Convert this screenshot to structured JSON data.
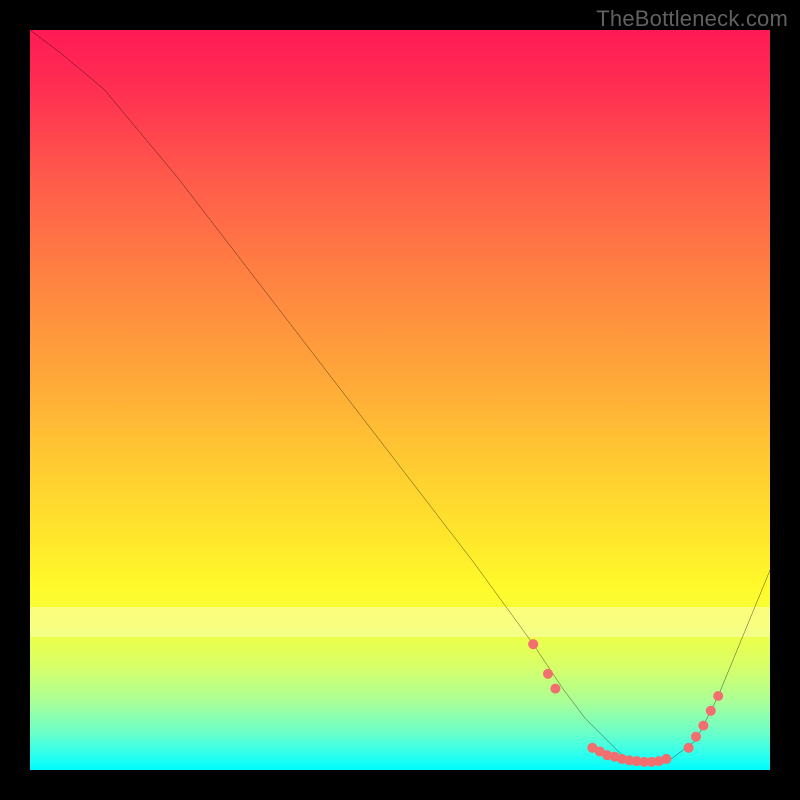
{
  "watermark": "TheBottleneck.com",
  "chart_data": {
    "type": "line",
    "title": "",
    "xlabel": "",
    "ylabel": "",
    "xlim": [
      0,
      100
    ],
    "ylim": [
      0,
      100
    ],
    "grid": false,
    "series": [
      {
        "name": "curve",
        "color": "#000000",
        "x": [
          0,
          4,
          10,
          20,
          30,
          40,
          50,
          60,
          68,
          72,
          75,
          78,
          80,
          83,
          86,
          90,
          93,
          100
        ],
        "y": [
          100,
          97,
          92,
          80,
          67,
          54,
          41,
          28,
          17,
          11,
          7,
          4,
          2,
          1,
          1,
          4,
          10,
          27
        ]
      }
    ],
    "markers": {
      "color": "#f36f6f",
      "radius": 5,
      "points": [
        {
          "x": 68,
          "y": 17
        },
        {
          "x": 70,
          "y": 13
        },
        {
          "x": 71,
          "y": 11
        },
        {
          "x": 76,
          "y": 3
        },
        {
          "x": 77,
          "y": 2.5
        },
        {
          "x": 78,
          "y": 2
        },
        {
          "x": 79,
          "y": 1.8
        },
        {
          "x": 80,
          "y": 1.5
        },
        {
          "x": 81,
          "y": 1.3
        },
        {
          "x": 82,
          "y": 1.2
        },
        {
          "x": 83,
          "y": 1.1
        },
        {
          "x": 84,
          "y": 1.1
        },
        {
          "x": 85,
          "y": 1.2
        },
        {
          "x": 86,
          "y": 1.5
        },
        {
          "x": 89,
          "y": 3
        },
        {
          "x": 90,
          "y": 4.5
        },
        {
          "x": 91,
          "y": 6
        },
        {
          "x": 92,
          "y": 8
        },
        {
          "x": 93,
          "y": 10
        }
      ]
    },
    "background_gradient": {
      "top": "#ff1a55",
      "mid": "#ffe52c",
      "bottom": "#00fcff"
    }
  }
}
